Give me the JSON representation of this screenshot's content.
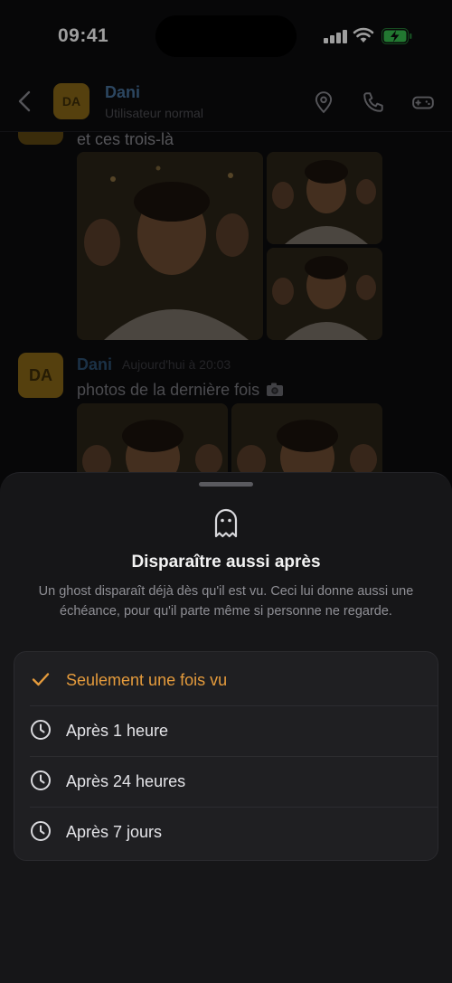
{
  "status": {
    "time": "09:41"
  },
  "header": {
    "avatar": "DA",
    "name": "Dani",
    "subtitle": "Utilisateur normal"
  },
  "messages": [
    {
      "text": "et ces trois-là"
    },
    {
      "avatar": "DA",
      "author": "Dani",
      "time": "Aujourd'hui à 20:03",
      "text": "photos de la dernière fois",
      "emoji": "camera-icon"
    }
  ],
  "sheet": {
    "icon": "ghost-icon",
    "title": "Disparaître aussi après",
    "description": "Un ghost disparaît déjà dès qu'il est vu. Ceci lui donne aussi une échéance, pour qu'il parte même si personne ne regarde.",
    "options": [
      {
        "label": "Seulement une fois vu",
        "icon": "check-icon",
        "selected": true
      },
      {
        "label": "Après 1 heure",
        "icon": "clock-icon",
        "selected": false
      },
      {
        "label": "Après 24 heures",
        "icon": "clock-icon",
        "selected": false
      },
      {
        "label": "Après 7 jours",
        "icon": "clock-icon",
        "selected": false
      }
    ]
  },
  "colors": {
    "accent": "#e59b3c",
    "author": "#47719b",
    "avatar": "#8a6818",
    "sheet": "#161618"
  }
}
